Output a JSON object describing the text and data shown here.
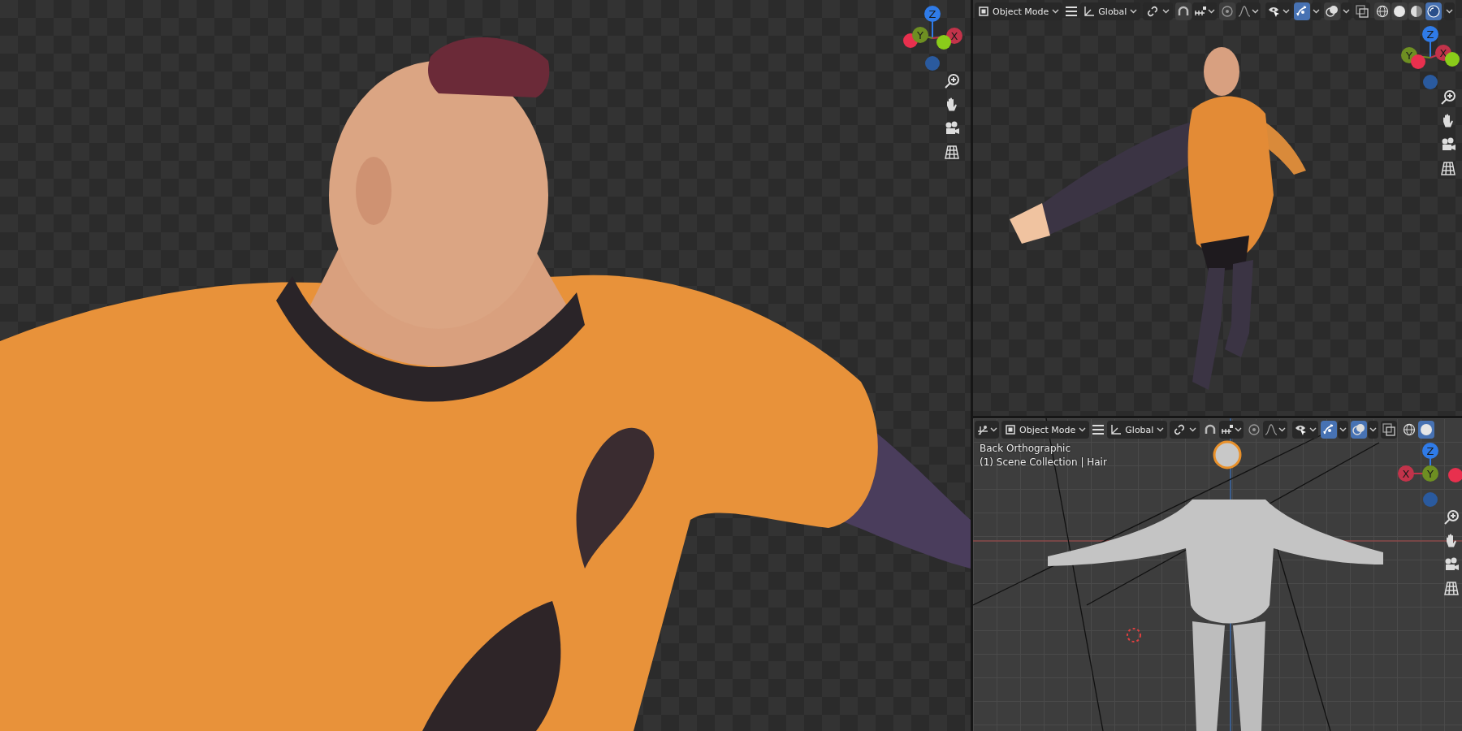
{
  "main_viewport": {
    "gizmo": {
      "kind": "perspective_main",
      "labels": [
        "Z",
        "Y",
        "X"
      ]
    }
  },
  "top_viewport": {
    "header": {
      "editor_type_button": false,
      "mode": "Object Mode",
      "orientation": "Global",
      "toggles": [
        {
          "kind": "snap",
          "on": false
        },
        {
          "kind": "proportional",
          "on": false
        },
        {
          "kind": "gizmo",
          "on": true
        },
        {
          "kind": "overlay",
          "on": false
        }
      ],
      "shading": [
        {
          "selected": false
        },
        {
          "selected": false
        },
        {
          "selected": false
        },
        {
          "selected": true
        }
      ]
    },
    "gizmo": {
      "kind": "perspective_top",
      "labels": [
        "Z",
        "Y",
        "X"
      ]
    }
  },
  "bottom_viewport": {
    "header": {
      "editor_type_button": true,
      "mode": "Object Mode",
      "orientation": "Global",
      "toggles": [
        {
          "kind": "snap",
          "on": false
        },
        {
          "kind": "proportional",
          "on": false
        },
        {
          "kind": "gizmo",
          "on": true
        },
        {
          "kind": "overlay",
          "on": true
        }
      ],
      "shading": [
        {
          "selected": false
        },
        {
          "selected": true
        }
      ]
    },
    "view_name": "Back Orthographic",
    "collection_info": "(1) Scene Collection | Hair",
    "gizmo": {
      "kind": "back",
      "labels": [
        "Z",
        "X",
        "Y"
      ]
    }
  }
}
